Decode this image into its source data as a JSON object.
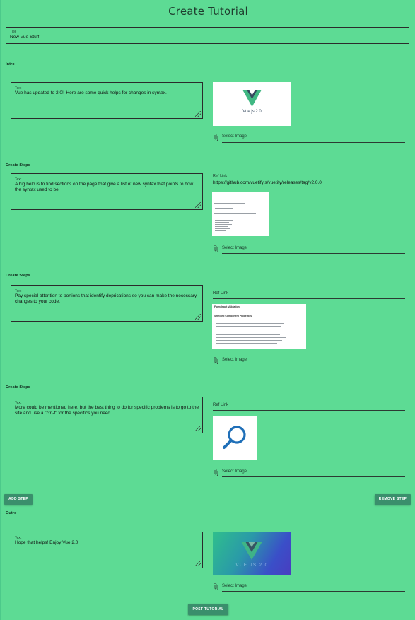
{
  "page": {
    "title": "Create Tutorial"
  },
  "title_field": {
    "label": "Title",
    "value": "New Vue Stuff"
  },
  "intro": {
    "section_label": "Intro",
    "text_label": "Text",
    "text_value": "Vue has updated to 2.0!  Here are some quick helps for changes in syntax.",
    "image_caption": "Vue.js 2.0",
    "select_image_label": "Select Image"
  },
  "steps": [
    {
      "section_label": "Create Steps",
      "text_label": "Text",
      "text_value": "A big help is to find sections on the page that give a list of new syntax that points to how the syntax used to be.",
      "ref_label": "Ref Link",
      "ref_value": "https://github.com/vuetifyjs/vuetify/releases/tag/v2.0.0",
      "select_image_label": "Select Image"
    },
    {
      "section_label": "Create Steps",
      "text_label": "Text",
      "text_value": "Pay special attention to portions that identify deprications so you can make the necessary changes to your code.",
      "ref_label": "Ref Link",
      "ref_value": "",
      "select_image_label": "Select Image"
    },
    {
      "section_label": "Create Steps",
      "text_label": "Text",
      "text_value": "More could be mentioned here, but the best thing to do for specific problems is to go to the site and use a \"ctrl-f\" for the specifics you need.",
      "ref_label": "Ref Link",
      "ref_value": "",
      "select_image_label": "Select Image"
    }
  ],
  "buttons": {
    "add_step": "ADD STEP",
    "remove_step": "REMOVE STEP",
    "post_tutorial": "POST TUTORIAL"
  },
  "outro": {
    "section_label": "Outro",
    "text_label": "Text",
    "text_value": "Hope that helps! Enjoy Vue 2.0",
    "image_caption": "VUE JS 2.0",
    "select_image_label": "Select Image"
  },
  "step2_image": {
    "heading": "Form Input Validation",
    "subheading": "Selected Component Properties"
  },
  "colors": {
    "background": "#5ddb94",
    "button": "#3a8f6c",
    "vue_green": "#41b883",
    "vue_dark": "#35495e"
  }
}
